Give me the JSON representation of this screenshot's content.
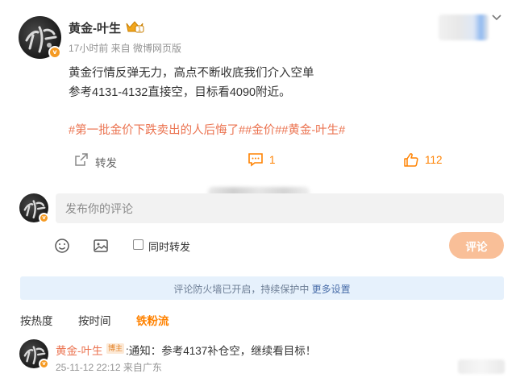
{
  "post": {
    "author": "黄金-叶生",
    "meta": "17小时前 来自 微博网页版",
    "line1": "黄金行情反弹无力，高点不断收底我们介入空单",
    "line2": "参考4131-4132直接空，目标看4090附近。",
    "tags": "#第一批金价下跌卖出的人后悔了##金价##黄金-叶生#",
    "avatar_text": "叶",
    "crown_level": "1"
  },
  "actions": {
    "repost": "转发",
    "comments": "1",
    "likes": "112"
  },
  "composer": {
    "placeholder": "发布你的评论",
    "repost_label": "同时转发",
    "submit": "评论"
  },
  "notice": {
    "text": "评论防火墙已开启，持续保护中 ",
    "link": "更多设置"
  },
  "sort_tabs": [
    "按热度",
    "按时间",
    "铁粉流"
  ],
  "comment": {
    "author": "黄金-叶生",
    "badge": "博主",
    "text": ":通知：参考4137补仓空，继续看目标！",
    "meta": "25-11-12 22:12 来自广东"
  },
  "colors": {
    "accent_orange": "#ff8200",
    "tag_orange": "#eb7350",
    "submit_disabled": "#f9bf98",
    "notice_bg": "#e6f1fc"
  },
  "icons": [
    "crown-icon",
    "chevron-down-icon",
    "share-icon",
    "comment-icon",
    "thumbs-up-icon",
    "emoji-icon",
    "image-icon",
    "verified-badge-icon"
  ]
}
